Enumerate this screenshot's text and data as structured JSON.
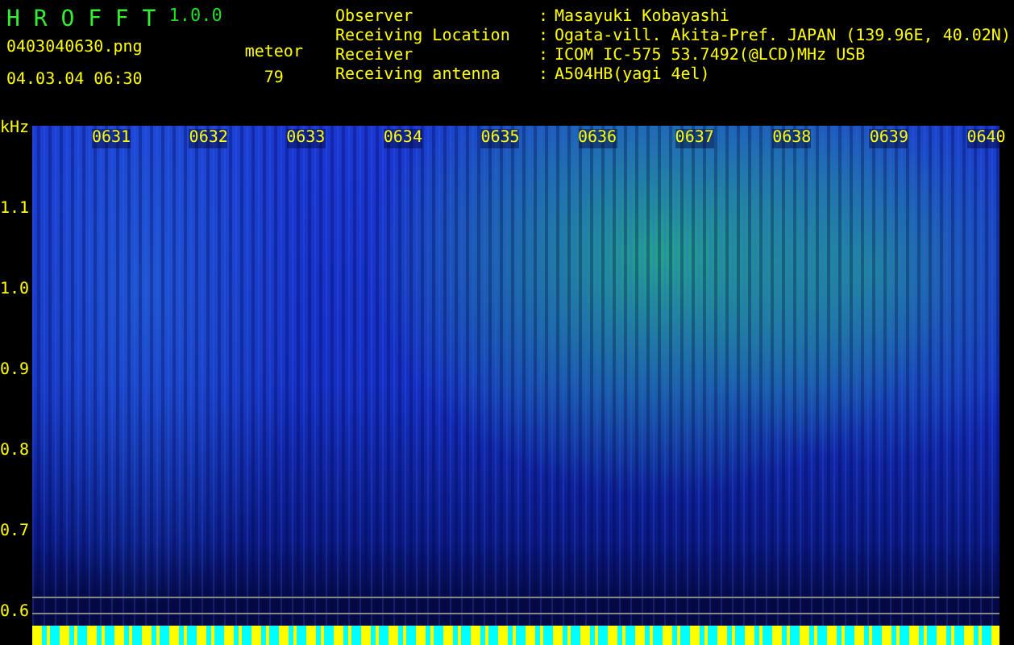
{
  "app": {
    "title": "H R O F F T",
    "version": "1.0.0"
  },
  "file": {
    "name": "0403040630.png",
    "datetime": "04.03.04 06:30"
  },
  "meteor": {
    "label": "meteor",
    "count": "79"
  },
  "info": [
    {
      "label": "Observer",
      "separator": ":",
      "value": "Masayuki Kobayashi"
    },
    {
      "label": "Receiving Location",
      "separator": ":",
      "value": "Ogata-vill. Akita-Pref. JAPAN (139.96E, 40.02N)"
    },
    {
      "label": "Receiver",
      "separator": ":",
      "value": "ICOM IC-575 53.7492(@LCD)MHz USB"
    },
    {
      "label": "Receiving antenna",
      "separator": ":",
      "value": "A504HB(yagi 4el)"
    }
  ],
  "spectrogram": {
    "y_unit": "kHz",
    "time_labels": [
      "0631",
      "0632",
      "0633",
      "0634",
      "0635",
      "0636",
      "0637",
      "0638",
      "0639",
      "0640"
    ],
    "freq_labels": [
      "1.1",
      "1.0",
      "0.9",
      "0.8",
      "0.7",
      "0.6"
    ]
  }
}
